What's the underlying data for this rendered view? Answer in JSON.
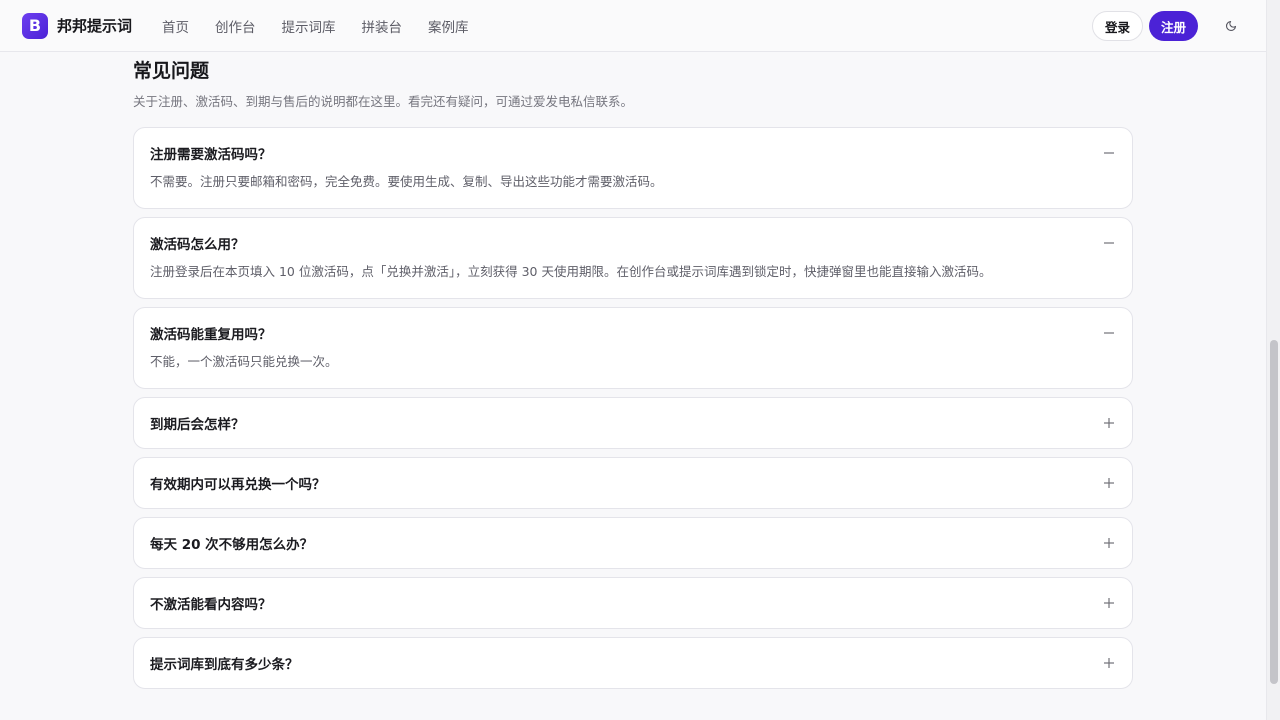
{
  "nav": {
    "logo_letter": "B",
    "brand": "邦邦提示词",
    "links": [
      "首页",
      "创作台",
      "提示词库",
      "拼装台",
      "案例库"
    ],
    "login_label": "登录",
    "register_label": "注册"
  },
  "faq": {
    "title": "常见问题",
    "description": "关于注册、激活码、到期与售后的说明都在这里。看完还有疑问，可通过爱发电私信联系。",
    "items": [
      {
        "question": "注册需要激活码吗？",
        "answer": "不需要。注册只要邮箱和密码，完全免费。要使用生成、复制、导出这些功能才需要激活码。",
        "expanded": true
      },
      {
        "question": "激活码怎么用？",
        "answer": "注册登录后在本页填入 10 位激活码，点「兑换并激活」，立刻获得 30 天使用期限。在创作台或提示词库遇到锁定时，快捷弹窗里也能直接输入激活码。",
        "expanded": true
      },
      {
        "question": "激活码能重复用吗？",
        "answer": "不能，一个激活码只能兑换一次。",
        "expanded": true
      },
      {
        "question": "到期后会怎样？",
        "answer": "",
        "expanded": false
      },
      {
        "question": "有效期内可以再兑换一个吗？",
        "answer": "",
        "expanded": false
      },
      {
        "question": "每天 20 次不够用怎么办？",
        "answer": "",
        "expanded": false
      },
      {
        "question": "不激活能看内容吗？",
        "answer": "",
        "expanded": false
      },
      {
        "question": "提示词库到底有多少条？",
        "answer": "",
        "expanded": false
      }
    ]
  }
}
